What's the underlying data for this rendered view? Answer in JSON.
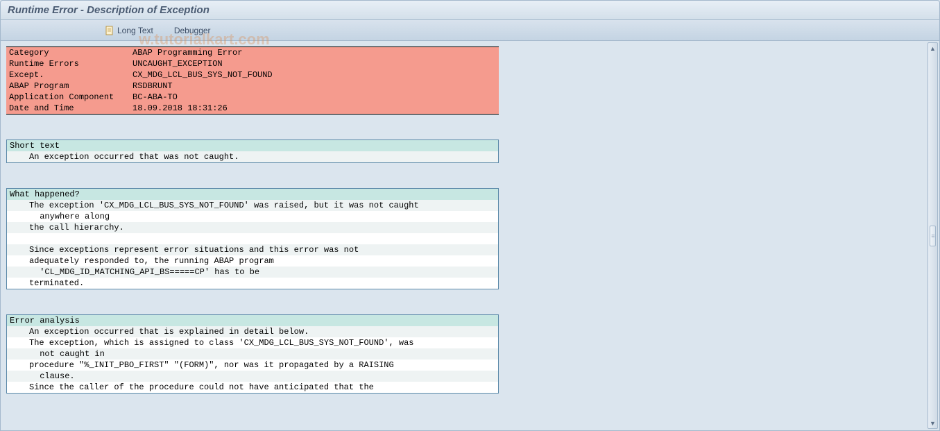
{
  "title": "Runtime Error - Description of Exception",
  "toolbar": {
    "long_text": "Long Text",
    "debugger": "Debugger"
  },
  "watermark": "w.tutorialkart.com",
  "summary": [
    {
      "label": "Category",
      "value": "ABAP Programming Error"
    },
    {
      "label": "Runtime Errors",
      "value": "UNCAUGHT_EXCEPTION"
    },
    {
      "label": "Except.",
      "value": "CX_MDG_LCL_BUS_SYS_NOT_FOUND"
    },
    {
      "label": "ABAP Program",
      "value": "RSDBRUNT"
    },
    {
      "label": "Application Component",
      "value": "BC-ABA-TO"
    },
    {
      "label": "Date and Time",
      "value": "18.09.2018 18:31:26"
    }
  ],
  "sections": {
    "short_text": {
      "header": "Short text",
      "lines": [
        {
          "text": "An exception occurred that was not caught.",
          "indent": 1
        }
      ]
    },
    "what_happened": {
      "header": "What happened?",
      "lines": [
        {
          "text": "The exception 'CX_MDG_LCL_BUS_SYS_NOT_FOUND' was raised, but it was not caught",
          "indent": 1
        },
        {
          "text": " anywhere along",
          "indent": 2
        },
        {
          "text": "the call hierarchy.",
          "indent": 1
        },
        {
          "text": "",
          "indent": 1
        },
        {
          "text": "Since exceptions represent error situations and this error was not",
          "indent": 1
        },
        {
          "text": "adequately responded to, the running ABAP program",
          "indent": 1
        },
        {
          "text": " 'CL_MDG_ID_MATCHING_API_BS=====CP' has to be",
          "indent": 2
        },
        {
          "text": "terminated.",
          "indent": 1
        }
      ]
    },
    "error_analysis": {
      "header": "Error analysis",
      "lines": [
        {
          "text": "An exception occurred that is explained in detail below.",
          "indent": 1
        },
        {
          "text": "The exception, which is assigned to class 'CX_MDG_LCL_BUS_SYS_NOT_FOUND', was",
          "indent": 1
        },
        {
          "text": " not caught in",
          "indent": 2
        },
        {
          "text": "procedure \"%_INIT_PBO_FIRST\" \"(FORM)\", nor was it propagated by a RAISING",
          "indent": 1
        },
        {
          "text": " clause.",
          "indent": 2
        },
        {
          "text": "Since the caller of the procedure could not have anticipated that the",
          "indent": 1
        }
      ]
    }
  }
}
